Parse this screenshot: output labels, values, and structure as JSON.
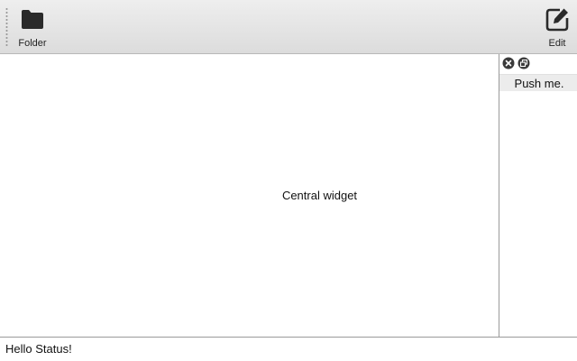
{
  "toolbar": {
    "folder_label": "Folder",
    "edit_label": "Edit",
    "folder_icon": "folder-icon",
    "edit_icon": "edit-icon"
  },
  "central": {
    "label": "Central widget"
  },
  "dock": {
    "close_icon": "close-icon",
    "float_icon": "float-icon",
    "button_label": "Push me."
  },
  "statusbar": {
    "text": "Hello Status!"
  },
  "colors": {
    "toolbar_top": "#eeeeee",
    "toolbar_bottom": "#dcdcdc",
    "icon": "#2a2a2a",
    "border": "#9a9a9a",
    "push_button_bg": "#ececec"
  }
}
